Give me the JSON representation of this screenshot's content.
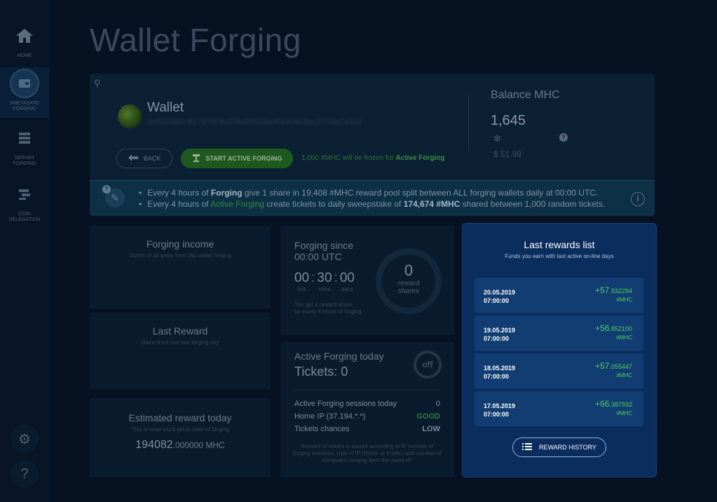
{
  "sidebar": {
    "items": [
      {
        "label": "HOME"
      },
      {
        "label": "#METAGATE FORGING"
      },
      {
        "label": "SERVER FORGING"
      },
      {
        "label": "COIN DELEGATION"
      }
    ]
  },
  "page": {
    "title": "Wallet Forging"
  },
  "wallet": {
    "name": "Wallet",
    "address": "0x00d3d5c81787dc6d5f8df53f46a9fa4c8c3bc3710a7a0c3",
    "back_label": "BACK",
    "forge_label": "START ACTIVE FORGING",
    "frozen_note_prefix": "1,000 #MHC will be frozen for ",
    "frozen_note_strong": "Active Forging"
  },
  "balance": {
    "label": "Balance MHC",
    "value": "1,645",
    "usd": "$ 51.99"
  },
  "info": {
    "line1": {
      "a": "Every 4 hours of ",
      "b": "Forging",
      "c": " give 1 share in 19,408 #MHC reward pool split between ALL forging wallets daily at 00:00 UTC."
    },
    "line2": {
      "a": "Every 4 hours of ",
      "b": "Active Forging",
      "c": " create tickets to daily sweepstake of ",
      "d": "174,674 #MHC",
      "e": " shared between 1,000 random tickets."
    }
  },
  "income": {
    "title": "Forging income",
    "subtitle": "Summ of all gains from this wallet forging"
  },
  "last_reward": {
    "title": "Last Reward",
    "subtitle": "Gains from one last forging day"
  },
  "estimated": {
    "title": "Estimated reward today",
    "subtitle": "This is what you'll get in case of forging",
    "value_main": "194082",
    "value_decimals": ".000000 MHC"
  },
  "forging_since": {
    "title_line1": "Forging since",
    "title_line2": "00:00 UTC",
    "hrs": "00",
    "mins": "30",
    "secs": "00",
    "hrs_label": "hrs",
    "mins_label": "mins",
    "secs_label": "secs",
    "note_line1": "You get 1 reward share",
    "note_line2": "for every 4 hours of forging",
    "shares_value": "0",
    "shares_label_1": "reward",
    "shares_label_2": "shares"
  },
  "active_forging": {
    "title": "Active Forging today",
    "tickets": "Tickets: 0",
    "off_label": "off",
    "rows": [
      {
        "label": "Active Forging sessions today",
        "value": "0"
      },
      {
        "label": "Home IP (37.194.*.*)",
        "value": "GOOD"
      },
      {
        "label": "Tickets chances",
        "value": "LOW"
      }
    ],
    "note": "Amount of tickets is issued according to IP number of forging sessions, type of IP (Home or Public) and number of computers forging form the same IP."
  },
  "rewards": {
    "title": "Last rewards list",
    "subtitle": "Funds you earn with last active on-line days",
    "items": [
      {
        "date": "20.05.2019",
        "time": "07:00:00",
        "int": "+57",
        "dec": ".932294",
        "cur": "#MHC"
      },
      {
        "date": "19.05.2019",
        "time": "07:00:00",
        "int": "+56",
        "dec": ".852100",
        "cur": "#MHC"
      },
      {
        "date": "18.05.2019",
        "time": "07:00:00",
        "int": "+57",
        "dec": ".055447",
        "cur": "#MHC"
      },
      {
        "date": "17.05.2019",
        "time": "07:00:00",
        "int": "+66",
        "dec": ".387932",
        "cur": "#MHC"
      }
    ],
    "history_button": "REWARD HISTORY"
  },
  "colors": {
    "accent_green": "#49d35b",
    "panel_blue": "#0b2d5e",
    "background": "#061222"
  }
}
